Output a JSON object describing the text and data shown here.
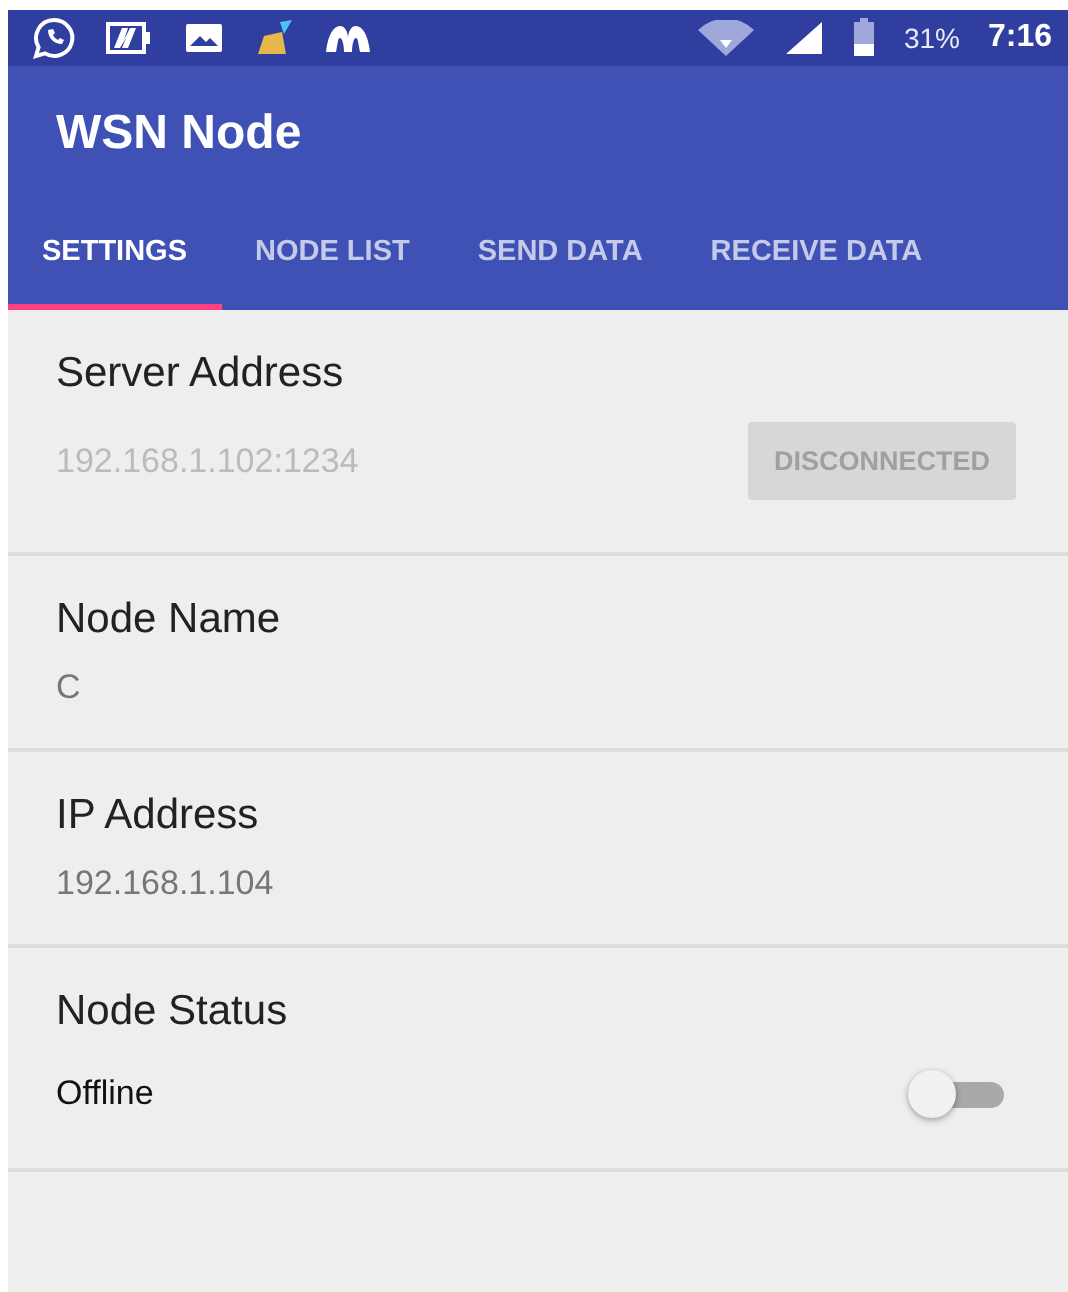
{
  "status_bar": {
    "battery": "31%",
    "time": "7:16"
  },
  "app_bar": {
    "title": "WSN Node"
  },
  "tabs": [
    {
      "label": "SETTINGS",
      "selected": true
    },
    {
      "label": "NODE LIST",
      "selected": false
    },
    {
      "label": "SEND DATA",
      "selected": false
    },
    {
      "label": "RECEIVE DATA",
      "selected": false
    }
  ],
  "settings": [
    {
      "kind": "server",
      "title": "Server Address",
      "value": "192.168.1.102:1234",
      "disabled": true,
      "button": {
        "label": "DISCONNECTED",
        "disabled": true
      }
    },
    {
      "kind": "text",
      "title": "Node Name",
      "value": "C"
    },
    {
      "kind": "text",
      "title": "IP Address",
      "value": "192.168.1.104"
    },
    {
      "kind": "switch",
      "title": "Node Status",
      "value": "Offline",
      "on": false
    }
  ]
}
